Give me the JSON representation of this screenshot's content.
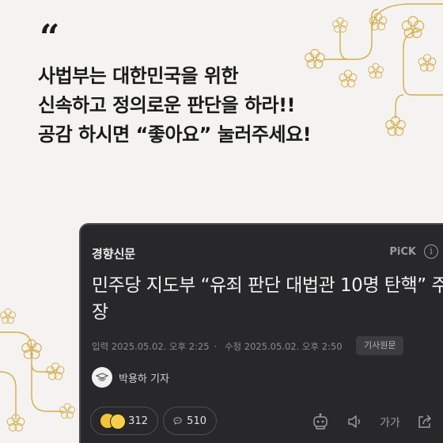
{
  "quote_mark": "“",
  "headline": {
    "line1": "사법부는 대한민국을 위한",
    "line2": "신속하고 정의로운 판단을 하라!!",
    "line3": "공감 하시면 “좋아요” 눌러주세요!"
  },
  "card": {
    "press_name": "경향신문",
    "pick_label": "PiCK",
    "info_symbol": "i",
    "title": "민주당 지도부 “유죄 판단 대법관 10명 탄핵” 주장",
    "input_date": "입력 2025.05.02. 오후 2:25",
    "separator": "·",
    "edit_date": "수정 2025.05.02. 오후 2:50",
    "source_button": "기사원문",
    "author": "박용하 기자",
    "reactions_count": "312",
    "comments_count": "510",
    "font_size_label": "가가"
  },
  "colors": {
    "background": "#f4f3f1",
    "blossom_gold": "#d4ac4a",
    "card_bg": "#28282a",
    "headline_text": "#1a1a1a"
  },
  "icons": [
    "blossom-branch",
    "info-icon",
    "author-avatar",
    "reaction-emoji",
    "comment-icon",
    "robot-summary-icon",
    "speaker-icon",
    "font-size-icon",
    "share-icon"
  ]
}
